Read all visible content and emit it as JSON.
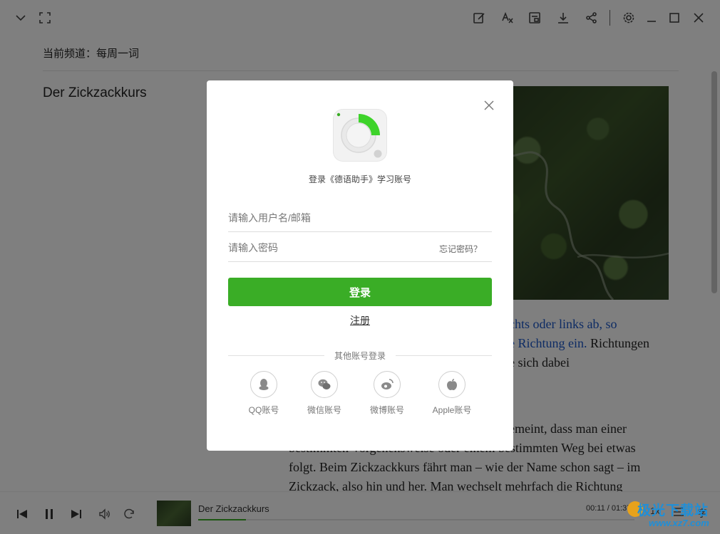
{
  "channel": {
    "label": "当前频道：每周一词"
  },
  "article": {
    "title": "Der Zickzackkurs",
    "lines": [
      {
        "pre": "",
        "link": "chts oder links ab, so",
        "post": ""
      },
      {
        "pre": "",
        "link": "e Richtung ein.",
        "post": " Richtungen"
      },
      {
        "pre": "e sich dabei",
        "link": "",
        "post": ""
      },
      {
        "pre": "emeint, dass man einer",
        "link": "",
        "post": ""
      },
      {
        "pre": "bestimmten Vorgehensweise oder einem bestimmten Weg bei etwas",
        "link": "",
        "post": ""
      },
      {
        "pre": "folgt. Beim Zickzackkurs fährt man – wie der Name schon sagt – im",
        "link": "",
        "post": ""
      },
      {
        "pre": "Zickzack, also hin und her. Man wechselt mehrfach die Richtung",
        "link": "",
        "post": ""
      }
    ]
  },
  "player": {
    "track_title": "Der Zickzackkurs",
    "time": "00:11 / 01:37",
    "speed": "1x",
    "progress": 0.11,
    "right_glyph": "字"
  },
  "dialog": {
    "title": "登录《德语助手》学习账号",
    "username_placeholder": "请输入用户名/邮箱",
    "password_placeholder": "请输入密码",
    "forgot": "忘记密码？",
    "login": "登录",
    "register": "注册",
    "other_label": "其他账号登录",
    "social": [
      {
        "label": "QQ账号",
        "icon": "qq-icon"
      },
      {
        "label": "微信账号",
        "icon": "wechat-icon"
      },
      {
        "label": "微博账号",
        "icon": "weibo-icon"
      },
      {
        "label": "Apple账号",
        "icon": "apple-icon"
      }
    ]
  },
  "watermark": {
    "line1": "极光下载站",
    "line2": "www.xz7.com"
  },
  "colors": {
    "accent": "#3aad26",
    "link": "#1a56c8",
    "overlay": "rgba(0,0,0,0.5)"
  }
}
